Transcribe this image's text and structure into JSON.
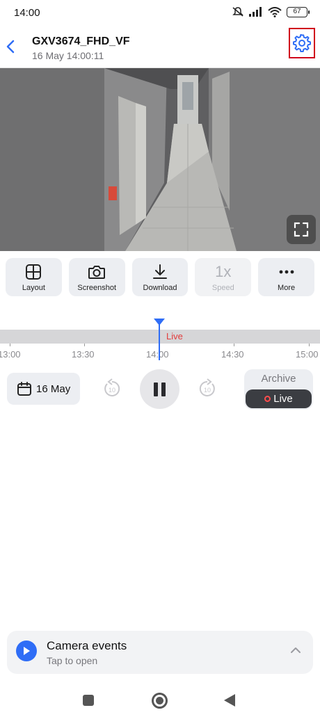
{
  "status_bar": {
    "time": "14:00",
    "battery": "67",
    "icons": [
      "mute-icon",
      "signal-icon",
      "wifi-icon",
      "battery-icon"
    ]
  },
  "header": {
    "title": "GXV3674_FHD_VF",
    "subtitle": "16 May 14:00:11",
    "back_icon": "chevron-left-icon",
    "settings_icon": "gear-icon",
    "accent_color": "#2f6df6",
    "highlight_color": "#d0021b"
  },
  "video": {
    "fullscreen_icon": "fullscreen-icon"
  },
  "toolbar": {
    "layout_label": "Layout",
    "screenshot_label": "Screenshot",
    "download_label": "Download",
    "speed_value": "1x",
    "speed_label": "Speed",
    "more_label": "More"
  },
  "timeline": {
    "live_label": "Live",
    "ticks": [
      "13:00",
      "13:30",
      "14:00",
      "14:30",
      "15:00"
    ],
    "live_color": "#e23b3b"
  },
  "controls": {
    "date_label": "16 May",
    "rewind_seconds": "10",
    "forward_seconds": "10",
    "archive_label": "Archive",
    "live_label": "Live"
  },
  "events": {
    "title": "Camera events",
    "subtitle": "Tap to open"
  }
}
